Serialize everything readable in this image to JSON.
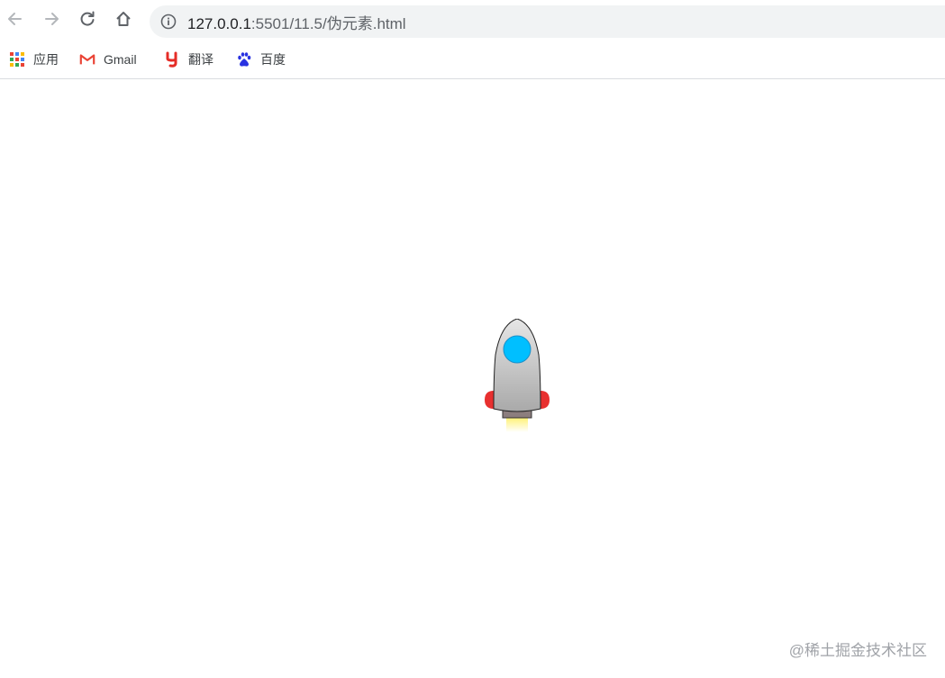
{
  "browser": {
    "nav": {
      "back_icon": "arrow-left-icon",
      "forward_icon": "arrow-right-icon",
      "reload_icon": "reload-icon",
      "home_icon": "home-icon"
    },
    "address_bar": {
      "info_icon": "info-icon",
      "url_host": "127.0.0.1",
      "url_path": ":5501/11.5/伪元素.html"
    },
    "bookmarks": [
      {
        "label": "应用",
        "icon": "apps-grid-icon"
      },
      {
        "label": "Gmail",
        "icon": "gmail-icon"
      },
      {
        "label": "翻译",
        "icon": "youdao-icon"
      },
      {
        "label": "百度",
        "icon": "baidu-paw-icon"
      }
    ]
  },
  "page": {
    "rocket": {
      "body_color": "#c8c8c8",
      "window_color": "#00bfff",
      "fin_color": "#e8302f",
      "nozzle_color": "#8c7e7e",
      "flame_color": "#fff59d"
    }
  },
  "watermark": "@稀土掘金技术社区",
  "colors": {
    "toolbar_bg": "#ffffff",
    "omnibox_bg": "#f1f3f4",
    "icon": "#5f6368"
  }
}
